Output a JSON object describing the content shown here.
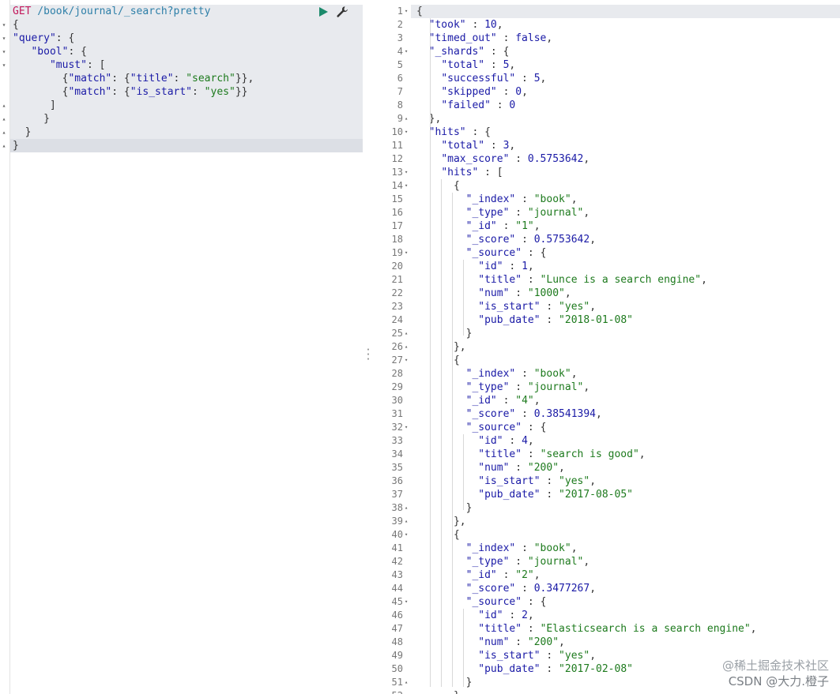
{
  "request": {
    "method": "GET",
    "url": "/book/journal/_search?pretty",
    "body_lines": [
      "{",
      "\"query\": {",
      "   \"bool\": {",
      "      \"must\": [",
      "        {\"match\": {\"title\": \"search\"}},",
      "        {\"match\": {\"is_start\": \"yes\"}}",
      "      ]",
      "     }",
      "  }",
      "}"
    ]
  },
  "toolbar": {
    "run_icon": "play-icon",
    "settings_icon": "wrench-icon"
  },
  "response": {
    "lines": [
      "{",
      "  \"took\" : 10,",
      "  \"timed_out\" : false,",
      "  \"_shards\" : {",
      "    \"total\" : 5,",
      "    \"successful\" : 5,",
      "    \"skipped\" : 0,",
      "    \"failed\" : 0",
      "  },",
      "  \"hits\" : {",
      "    \"total\" : 3,",
      "    \"max_score\" : 0.5753642,",
      "    \"hits\" : [",
      "      {",
      "        \"_index\" : \"book\",",
      "        \"_type\" : \"journal\",",
      "        \"_id\" : \"1\",",
      "        \"_score\" : 0.5753642,",
      "        \"_source\" : {",
      "          \"id\" : 1,",
      "          \"title\" : \"Lunce is a search engine\",",
      "          \"num\" : \"1000\",",
      "          \"is_start\" : \"yes\",",
      "          \"pub_date\" : \"2018-01-08\"",
      "        }",
      "      },",
      "      {",
      "        \"_index\" : \"book\",",
      "        \"_type\" : \"journal\",",
      "        \"_id\" : \"4\",",
      "        \"_score\" : 0.38541394,",
      "        \"_source\" : {",
      "          \"id\" : 4,",
      "          \"title\" : \"search is good\",",
      "          \"num\" : \"200\",",
      "          \"is_start\" : \"yes\",",
      "          \"pub_date\" : \"2017-08-05\"",
      "        }",
      "      },",
      "      {",
      "        \"_index\" : \"book\",",
      "        \"_type\" : \"journal\",",
      "        \"_id\" : \"2\",",
      "        \"_score\" : 0.3477267,",
      "        \"_source\" : {",
      "          \"id\" : 2,",
      "          \"title\" : \"Elasticsearch is a search engine\",",
      "          \"num\" : \"200\",",
      "          \"is_start\" : \"yes\",",
      "          \"pub_date\" : \"2017-02-08\"",
      "        }",
      "      }"
    ]
  },
  "watermark": {
    "line1": "@稀土掘金技术社区",
    "line2": "CSDN @大力.橙子"
  }
}
